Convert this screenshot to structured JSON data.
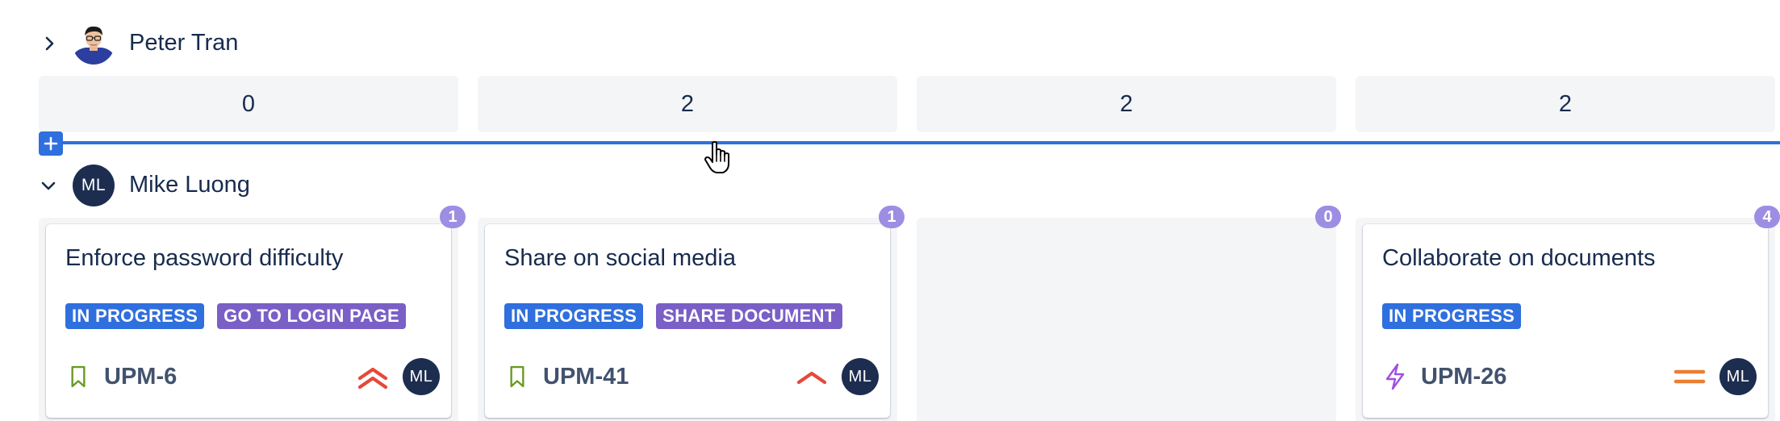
{
  "lanes": [
    {
      "name": "Peter Tran",
      "expanded": false,
      "column_counts": [
        "0",
        "2",
        "2",
        "2"
      ]
    },
    {
      "name": "Mike Luong",
      "initials": "ML",
      "expanded": true,
      "columns": [
        {
          "count": "1",
          "card": {
            "title": "Enforce password difficulty",
            "tags": [
              "IN PROGRESS",
              "GO TO LOGIN PAGE"
            ],
            "type_icon": "story-bookmark-icon",
            "key": "UPM-6",
            "priority_icon": "priority-highest-icon",
            "assignee_initials": "ML"
          }
        },
        {
          "count": "1",
          "card": {
            "title": "Share on social media",
            "tags": [
              "IN PROGRESS",
              "SHARE DOCUMENT"
            ],
            "type_icon": "story-bookmark-icon",
            "key": "UPM-41",
            "priority_icon": "priority-high-icon",
            "assignee_initials": "ML"
          }
        },
        {
          "count": "0"
        },
        {
          "count": "4",
          "card": {
            "title": "Collaborate on documents",
            "tags": [
              "IN PROGRESS"
            ],
            "type_icon": "epic-lightning-icon",
            "key": "UPM-26",
            "priority_icon": "priority-medium-icon",
            "assignee_initials": "ML"
          }
        }
      ]
    }
  ],
  "colors": {
    "in_progress_tag": "#2f6fde",
    "epic_tag": "#7a5fc6",
    "count_badge": "#9d8ee3",
    "drop_indicator": "#2f6fde",
    "avatar": "#1d2d50",
    "story_icon": "#6a9a23",
    "epic_icon": "#a04fe0",
    "priority_high": "#e5493a",
    "priority_medium": "#e97f33"
  }
}
